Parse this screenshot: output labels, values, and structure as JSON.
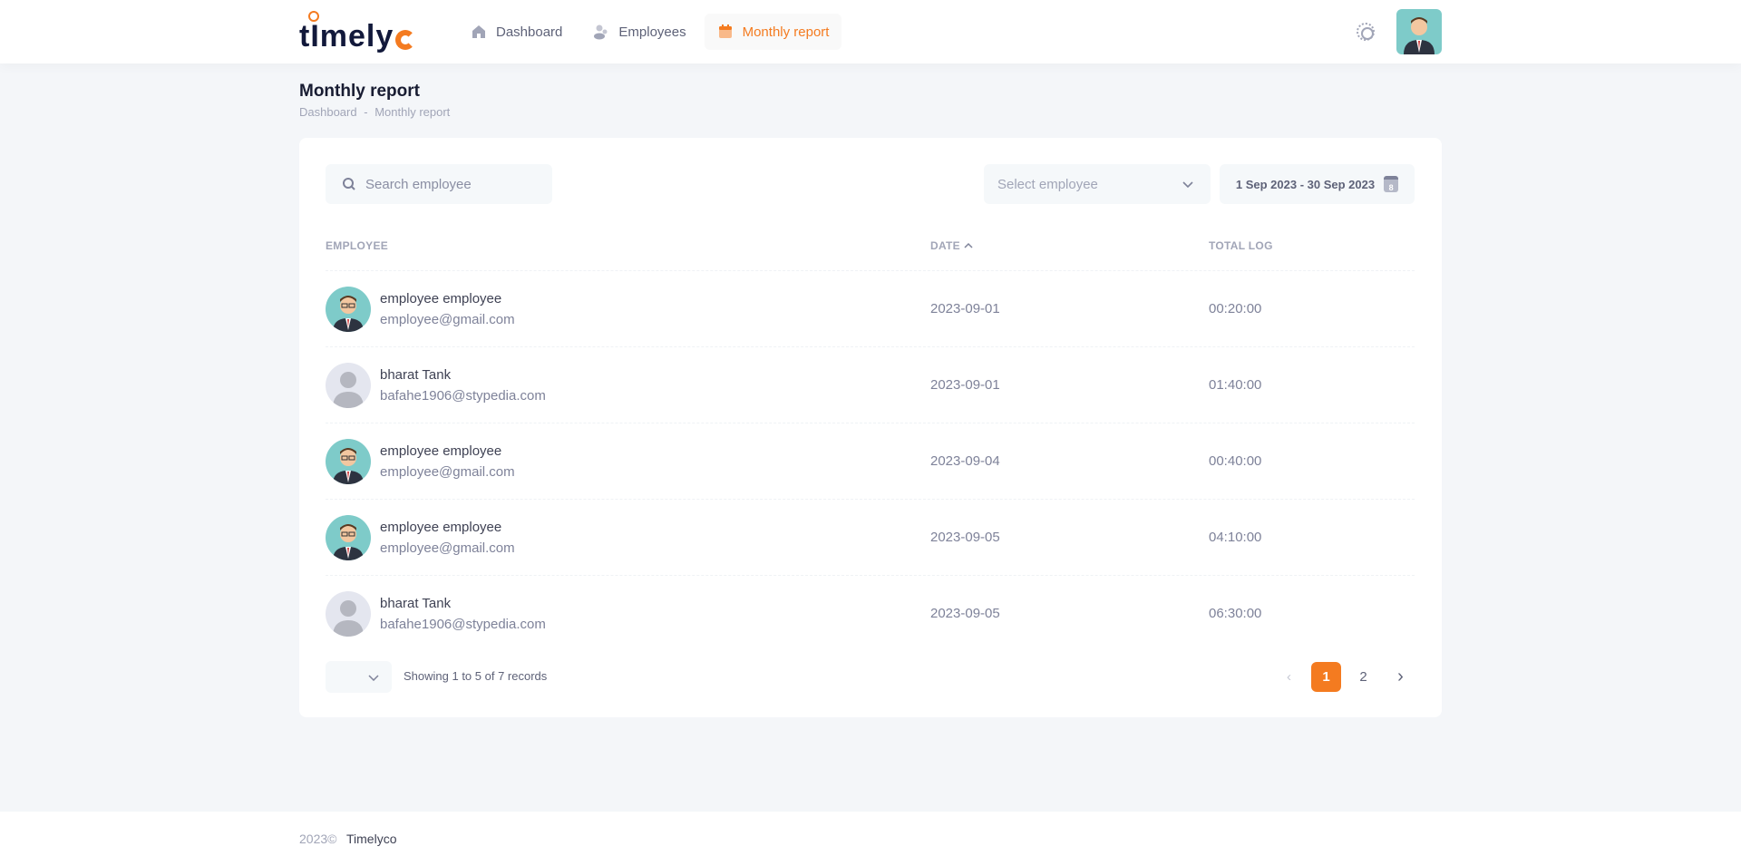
{
  "brand": {
    "name": "timelyco",
    "accent": "#f47b20"
  },
  "nav": [
    {
      "label": "Dashboard",
      "icon": "home-icon"
    },
    {
      "label": "Employees",
      "icon": "users-icon"
    },
    {
      "label": "Monthly report",
      "icon": "calendar-icon",
      "active": true
    }
  ],
  "page": {
    "title": "Monthly report",
    "breadcrumb": [
      "Dashboard",
      "-",
      "Monthly report"
    ]
  },
  "filters": {
    "search_placeholder": "Search employee",
    "select_placeholder": "Select employee",
    "date_range": "1 Sep 2023 - 30 Sep 2023",
    "calendar_day": "8"
  },
  "table": {
    "headers": [
      "EMPLOYEE",
      "DATE",
      "TOTAL LOG"
    ],
    "rows": [
      {
        "name": "employee employee",
        "email": "employee@gmail.com",
        "date": "2023-09-01",
        "total": "00:20:00",
        "avatar": "photo"
      },
      {
        "name": "bharat Tank",
        "email": "bafahe1906@stypedia.com",
        "date": "2023-09-01",
        "total": "01:40:00",
        "avatar": "blank"
      },
      {
        "name": "employee employee",
        "email": "employee@gmail.com",
        "date": "2023-09-04",
        "total": "00:40:00",
        "avatar": "photo"
      },
      {
        "name": "employee employee",
        "email": "employee@gmail.com",
        "date": "2023-09-05",
        "total": "04:10:00",
        "avatar": "photo"
      },
      {
        "name": "bharat Tank",
        "email": "bafahe1906@stypedia.com",
        "date": "2023-09-05",
        "total": "06:30:00",
        "avatar": "blank"
      }
    ]
  },
  "pagination": {
    "summary": "Showing 1 to 5 of 7 records",
    "pages": [
      "1",
      "2"
    ],
    "current": "1"
  },
  "footer": {
    "year": "2023©",
    "company": "Timelyco"
  }
}
